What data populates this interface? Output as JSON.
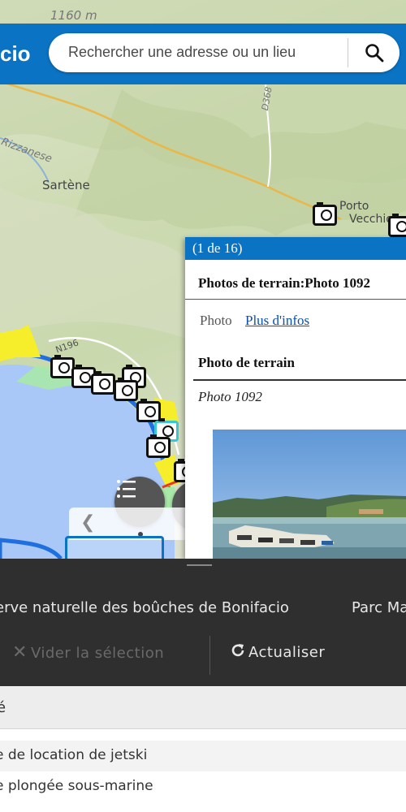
{
  "map": {
    "labels": {
      "elevation": "1160 m",
      "sartene": "Sartène",
      "porto": "Porto",
      "vecchio": "Vecchio",
      "road_d368": "D368",
      "river": "Rizzanese",
      "road_n196": "N196"
    },
    "colors": {
      "sea": "#a9c8f7",
      "zone_yellow": "#f6ee2a",
      "zone_blue_border": "#1f6fe0",
      "zone_green": "#a8e8a8",
      "zone_red": "#e8362a"
    },
    "layers_button_icon": "list-icon",
    "carousel_prev_icon": "chevron-left-icon"
  },
  "header": {
    "app_title": "cio",
    "search_placeholder": "Rechercher une adresse ou un lieu",
    "search_icon": "search-icon"
  },
  "popup": {
    "counter": "(1 de 16)",
    "title": "Photos de terrain:Photo 1092",
    "photo_label": "Photo",
    "more_info_link": "Plus d'infos",
    "type_heading": "Photo de terrain",
    "caption": "Photo 1092"
  },
  "panel": {
    "tabs": [
      {
        "label": "erve naturelle des boûches de Bonifacio"
      },
      {
        "label": "Parc Ma"
      }
    ],
    "clear_selection_label": "Vider la sélection",
    "refresh_label": "Actualiser",
    "clear_icon": "close-icon",
    "refresh_icon": "refresh-icon"
  },
  "list": {
    "header": "é",
    "rows": [
      {
        "label": "e de location de jetski"
      },
      {
        "label": "e plongée sous-marine"
      }
    ]
  }
}
